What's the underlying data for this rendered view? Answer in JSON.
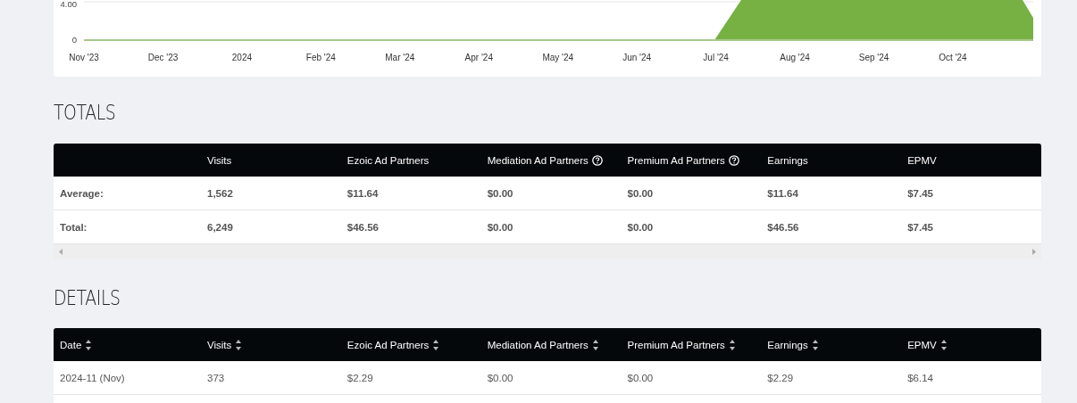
{
  "chart": {
    "y_labels": [
      "4.00",
      "0"
    ],
    "x_labels": [
      "Nov '23",
      "Dec '23",
      "2024",
      "Feb '24",
      "Mar '24",
      "Apr '24",
      "May '24",
      "Jun '24",
      "Jul '24",
      "Aug '24",
      "Sep '24",
      "Oct '24"
    ]
  },
  "totals": {
    "title": "TOTALS",
    "columns": [
      {
        "label": "Visits",
        "help": false
      },
      {
        "label": "Ezoic Ad Partners",
        "help": false
      },
      {
        "label": "Mediation Ad Partners",
        "help": true
      },
      {
        "label": "Premium Ad Partners",
        "help": true
      },
      {
        "label": "Earnings",
        "help": false
      },
      {
        "label": "EPMV",
        "help": false
      }
    ],
    "rows": [
      {
        "label": "Average:",
        "cells": [
          "1,562",
          "$11.64",
          "$0.00",
          "$0.00",
          "$11.64",
          "$7.45"
        ]
      },
      {
        "label": "Total:",
        "cells": [
          "6,249",
          "$46.56",
          "$0.00",
          "$0.00",
          "$46.56",
          "$7.45"
        ]
      }
    ]
  },
  "details": {
    "title": "DETAILS",
    "columns": [
      {
        "label": "Date",
        "sortable": true
      },
      {
        "label": "Visits",
        "sortable": true
      },
      {
        "label": "Ezoic Ad Partners",
        "sortable": true
      },
      {
        "label": "Mediation Ad Partners",
        "sortable": true
      },
      {
        "label": "Premium Ad Partners",
        "sortable": true
      },
      {
        "label": "Earnings",
        "sortable": true
      },
      {
        "label": "EPMV",
        "sortable": true
      }
    ],
    "rows": [
      [
        "2024-11 (Nov)",
        "373",
        "$2.29",
        "$0.00",
        "$0.00",
        "$2.29",
        "$6.14"
      ]
    ]
  }
}
